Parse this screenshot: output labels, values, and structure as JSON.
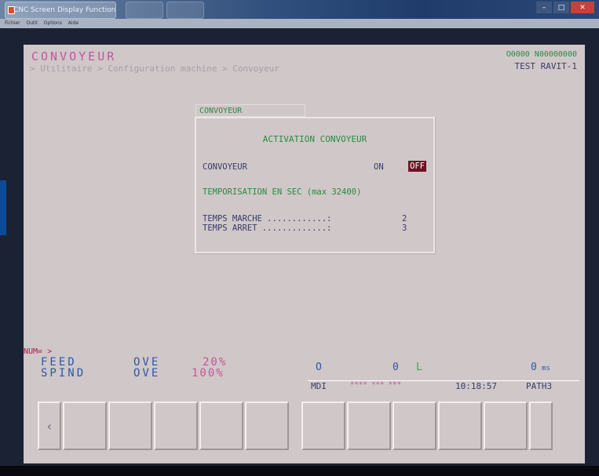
{
  "window": {
    "title": "CNC Screen Display Function",
    "menu": [
      "Fichier",
      "Outil",
      "Options",
      "Aide"
    ],
    "controls": [
      "–",
      "□",
      "✕"
    ]
  },
  "screen": {
    "title": "CONVOYEUR",
    "breadcrumb": "> Utilitaire > Configuration machine > Convoyeur",
    "program": "O0000 N00000000",
    "machine": "TEST RAVIT-1"
  },
  "dialog": {
    "tab_label": "CONVOYEUR",
    "heading": "ACTIVATION CONVOYEUR",
    "convoyeur_label": "CONVOYEUR",
    "on_label": "ON",
    "off_label": "OFF",
    "off_selected": true,
    "tempo_label": "TEMPORISATION EN SEC (max 32400)",
    "temps_marche_label": "TEMPS MARCHE ............:",
    "temps_marche_value": "2",
    "temps_arret_label": "TEMPS ARRET .............:",
    "temps_arret_value": "3"
  },
  "status": {
    "num_prompt": "NUM= >",
    "feed_label": "FEED",
    "spind_label": "SPIND",
    "ove_label": "OVE",
    "feed_override": "20%",
    "spind_override": "100%",
    "o_label": "O",
    "o_value": "0",
    "l_label": "L",
    "l_value": "0",
    "ms_label": "ms",
    "mode": "MDI",
    "stars": "**** *** ***",
    "time": "10:18:57",
    "path": "PATH3"
  },
  "softkeys": {
    "left_arrow": "‹"
  },
  "colors": {
    "screen_bg": "#cfc7c8",
    "title_magenta": "#c5569a",
    "label_navy": "#3a3c6a",
    "green": "#2c8a42",
    "off_highlight": "#6a1424"
  }
}
